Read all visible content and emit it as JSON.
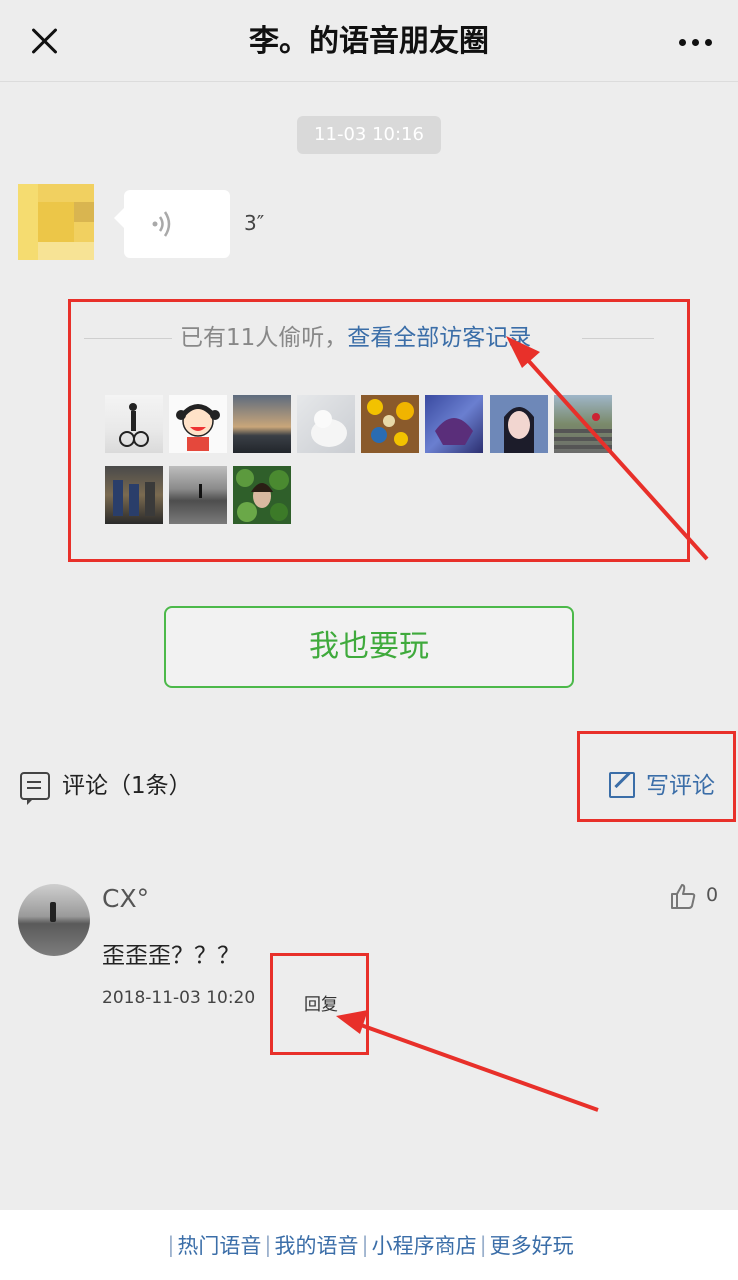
{
  "header": {
    "title": "李。的语音朋友圈"
  },
  "message": {
    "timestamp": "11-03 10:16",
    "duration": "3″"
  },
  "visitors": {
    "count_text": "已有11人偷听，",
    "link_text": "查看全部访客记录",
    "avatars": [
      "cyclist",
      "cartoon-girl",
      "sunset",
      "cat",
      "lemons",
      "underwater",
      "girl",
      "stairs",
      "room",
      "beach",
      "leaves"
    ]
  },
  "play_button": {
    "label": "我也要玩"
  },
  "comments": {
    "label": "评论（1条）",
    "write_label": "写评论",
    "items": [
      {
        "name": "CX°",
        "text": "歪歪歪？？？",
        "date": "2018-11-03 10:20",
        "reply": "回复",
        "likes": "0"
      }
    ]
  },
  "footer": {
    "links": [
      "热门语音",
      "我的语音",
      "小程序商店",
      "更多好玩"
    ]
  },
  "colors": {
    "highlight_red": "#e8302a",
    "link_blue": "#3b6ea8",
    "button_green": "#4cb94a"
  }
}
